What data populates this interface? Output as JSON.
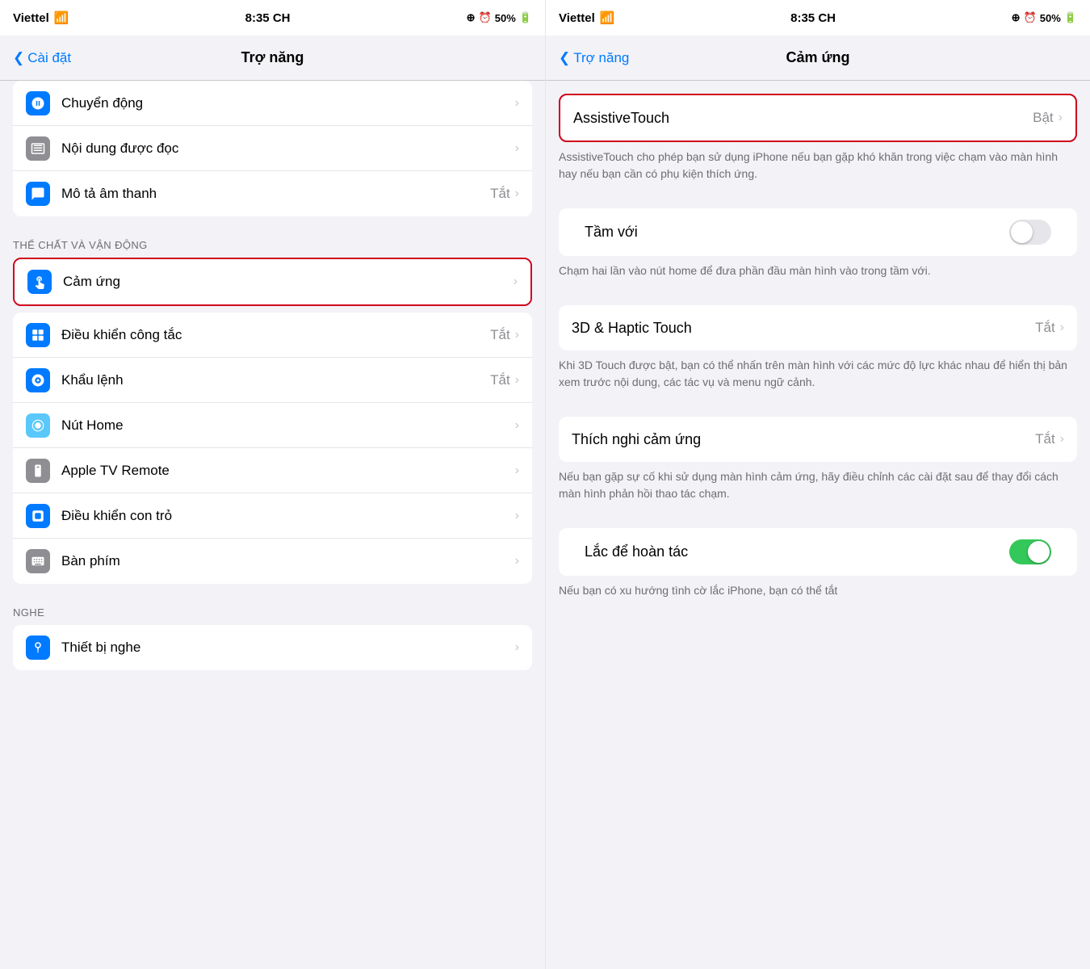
{
  "left": {
    "statusBar": {
      "carrier": "Viettel",
      "wifi": true,
      "time": "8:35 CH",
      "battery": "50%"
    },
    "navBack": "Cài đặt",
    "navTitle": "Trợ năng",
    "sections": [
      {
        "rows": [
          {
            "icon": "motion",
            "iconBg": "blue",
            "iconChar": "↕",
            "label": "Chuyển động",
            "value": "",
            "chevron": true
          },
          {
            "icon": "content-read",
            "iconBg": "gray",
            "iconChar": "📄",
            "label": "Nội dung được đọc",
            "value": "",
            "chevron": true
          },
          {
            "icon": "audio-desc",
            "iconBg": "blue2",
            "iconChar": "💬",
            "label": "Mô tả âm thanh",
            "value": "Tắt",
            "chevron": true
          }
        ]
      }
    ],
    "sectionHeaders": [
      {
        "label": "THỂ CHẤT VÀ VẬN ĐỘNG"
      }
    ],
    "physicalSection": {
      "rows": [
        {
          "icon": "touch",
          "iconBg": "blue",
          "iconChar": "✋",
          "label": "Cảm ứng",
          "value": "",
          "chevron": true,
          "highlighted": true
        },
        {
          "icon": "switch",
          "iconBg": "blue",
          "iconChar": "⊞",
          "label": "Điều khiển công tắc",
          "value": "Tắt",
          "chevron": true
        },
        {
          "icon": "voice",
          "iconBg": "blue",
          "iconChar": "🎮",
          "label": "Khẩu lệnh",
          "value": "Tắt",
          "chevron": true
        },
        {
          "icon": "home",
          "iconBg": "teal",
          "iconChar": "⬜",
          "label": "Nút Home",
          "value": "",
          "chevron": true
        },
        {
          "icon": "tv-remote",
          "iconBg": "gray",
          "iconChar": "📺",
          "label": "Apple TV Remote",
          "value": "",
          "chevron": true
        },
        {
          "icon": "pointer",
          "iconBg": "blue",
          "iconChar": "⬛",
          "label": "Điều khiển con trỏ",
          "value": "",
          "chevron": true
        },
        {
          "icon": "keyboard",
          "iconBg": "gray",
          "iconChar": "⌨",
          "label": "Bàn phím",
          "value": "",
          "chevron": true
        }
      ]
    },
    "listeningHeader": {
      "label": "NGHE"
    },
    "listeningSection": {
      "rows": [
        {
          "icon": "hearing",
          "iconBg": "blue",
          "iconChar": "👂",
          "label": "Thiết bị nghe",
          "value": "",
          "chevron": true
        }
      ]
    }
  },
  "right": {
    "statusBar": {
      "carrier": "Viettel",
      "wifi": true,
      "time": "8:35 CH",
      "battery": "50%"
    },
    "navBack": "Trợ năng",
    "navTitle": "Cảm ứng",
    "assistiveTouch": {
      "label": "AssistiveTouch",
      "value": "Bật",
      "desc": "AssistiveTouch cho phép bạn sử dụng iPhone nếu bạn gặp khó khăn trong việc chạm vào màn hình hay nếu bạn cần có phụ kiện thích ứng."
    },
    "tamVoi": {
      "label": "Tầm với",
      "toggleOn": false,
      "desc": "Chạm hai lần vào nút home để đưa phần đầu màn hình vào trong tầm với."
    },
    "hapticTouch": {
      "label": "3D & Haptic Touch",
      "value": "Tắt",
      "desc": "Khi 3D Touch được bật, bạn có thể nhấn trên màn hình với các mức độ lực khác nhau để hiển thị bản xem trước nội dung, các tác vụ và menu ngữ cảnh."
    },
    "thichNghi": {
      "label": "Thích nghi cảm ứng",
      "value": "Tắt",
      "desc": "Nếu bạn gặp sự cố khi sử dụng màn hình cảm ứng, hãy điều chỉnh các cài đặt sau để thay đổi cách màn hình phản hồi thao tác chạm."
    },
    "lacDe": {
      "label": "Lắc để hoàn tác",
      "toggleOn": true,
      "desc": "Nếu bạn có xu hướng tình cờ lắc iPhone, bạn có thể tắt"
    }
  }
}
